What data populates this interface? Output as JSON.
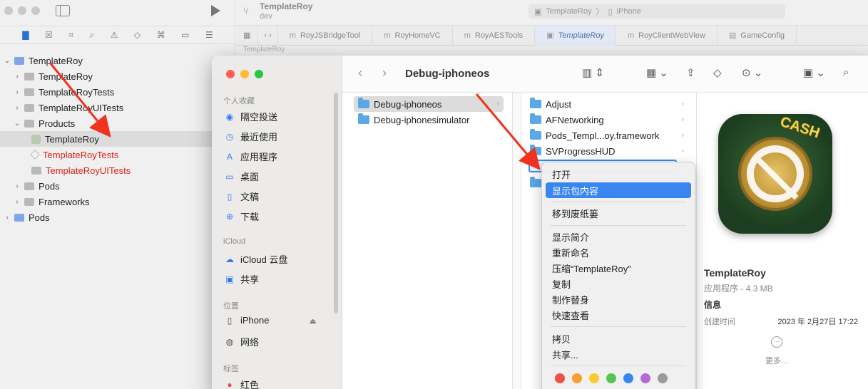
{
  "xcode": {
    "project_name": "TemplateRoy",
    "branch": "dev",
    "scheme": {
      "target": "TemplateRoy",
      "device": "iPhone"
    },
    "tabs": [
      {
        "label": "RoyJSBridgeTool"
      },
      {
        "label": "RoyHomeVC"
      },
      {
        "label": "RoyAESTools"
      },
      {
        "label": "TemplateRoy"
      },
      {
        "label": "RoyClientWebView"
      },
      {
        "label": "GameConfig"
      }
    ],
    "breadcrumb": "TemplateRoy",
    "tree": [
      {
        "label": "TemplateRoy"
      },
      {
        "label": "TemplateRoy"
      },
      {
        "label": "TemplateRoyTests"
      },
      {
        "label": "TemplateRoyUITests"
      },
      {
        "label": "Products"
      },
      {
        "label": "TemplateRoy"
      },
      {
        "label": "TemplateRoyTests"
      },
      {
        "label": "TemplateRoyUITests"
      },
      {
        "label": "Pods"
      },
      {
        "label": "Frameworks"
      },
      {
        "label": "Pods"
      }
    ]
  },
  "finder": {
    "title": "Debug-iphoneos",
    "sidebar": {
      "favorites_header": "个人收藏",
      "favorites": [
        "隔空投送",
        "最近使用",
        "应用程序",
        "桌面",
        "文稿",
        "下载"
      ],
      "icloud_header": "iCloud",
      "icloud": [
        "iCloud 云盘",
        "共享"
      ],
      "locations_header": "位置",
      "locations": [
        "iPhone",
        "网络"
      ],
      "tags_header": "标签",
      "tags": [
        "红色"
      ]
    },
    "col1": [
      "Debug-iphoneos",
      "Debug-iphonesimulator"
    ],
    "col2": [
      "Adjust",
      "AFNetworking",
      "Pods_Templ...oy.framework",
      "SVProgressHUD"
    ],
    "preview": {
      "name": "TemplateRoy",
      "kind": "应用程序 - 4.3 MB",
      "info_header": "信息",
      "created_label": "创建时间",
      "created_value": "2023 年 2月27日 17:22",
      "more": "更多...",
      "icon_text": "CASH"
    }
  },
  "context_menu": {
    "items": [
      "打开",
      "显示包内容",
      "移到废纸篓",
      "显示简介",
      "重新命名",
      "压缩“TemplateRoy”",
      "复制",
      "制作替身",
      "快速查看",
      "拷贝",
      "共享..."
    ],
    "highlighted": "显示包内容",
    "tag_colors": [
      "#f0504a",
      "#f5a030",
      "#f6cc2e",
      "#56c453",
      "#3a86f0",
      "#b06ad8",
      "#9a9a9a"
    ]
  },
  "colors": {
    "accent": "#3a86f0",
    "annotation_arrow": "#f0321e",
    "error_red": "#e0201a"
  }
}
